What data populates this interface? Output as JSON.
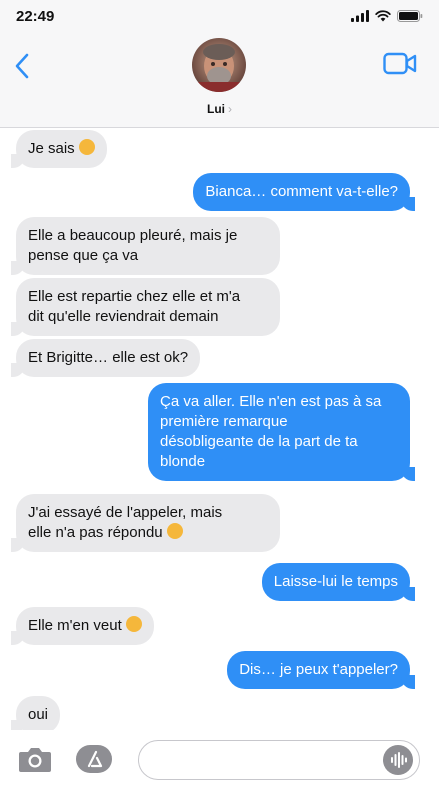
{
  "status_bar": {
    "time": "22:49"
  },
  "header": {
    "contact_name": "Lui",
    "chevron": "›"
  },
  "messages": [
    {
      "dir": "in",
      "text": "Je sais",
      "emoji": "relieved-face-emoji"
    },
    {
      "dir": "out",
      "text": "Bianca… comment va-t-elle?"
    },
    {
      "dir": "in",
      "lines": [
        "Elle a beaucoup pleuré, mais je",
        "pense que ça va"
      ]
    },
    {
      "dir": "in",
      "lines": [
        "Elle est repartie chez elle et m'a",
        "dit qu'elle reviendrait demain"
      ]
    },
    {
      "dir": "in",
      "text": "Et Brigitte… elle est ok?"
    },
    {
      "dir": "out",
      "lines": [
        "Ça va aller. Elle n'en est pas à sa",
        "première remarque",
        "désobligeante de la part de ta",
        "blonde"
      ]
    },
    {
      "dir": "in",
      "lines": [
        "J'ai essayé de l'appeler, mais",
        "elle n'a pas répondu"
      ],
      "emoji": "flushed-face-emoji"
    },
    {
      "dir": "out",
      "text": "Laisse-lui le temps"
    },
    {
      "dir": "in",
      "text": "Elle m'en veut",
      "emoji": "flushed-face-emoji"
    },
    {
      "dir": "out",
      "text": "Dis… je peux t'appeler?"
    },
    {
      "dir": "in",
      "text": "oui"
    }
  ],
  "composer": {
    "placeholder": "",
    "value": ""
  },
  "icons": {
    "back": "chevron-left-icon",
    "video": "video-camera-icon",
    "camera": "camera-icon",
    "apps": "app-store-icon",
    "audio": "audio-waveform-icon",
    "signal": "signal-icon",
    "wifi": "wifi-icon",
    "battery": "battery-icon"
  },
  "colors": {
    "accent": "#2f8ff6",
    "incoming_bubble": "#e9e9eb",
    "header_bg": "#f7f7f8",
    "emoji_face": "#f5b73b"
  }
}
